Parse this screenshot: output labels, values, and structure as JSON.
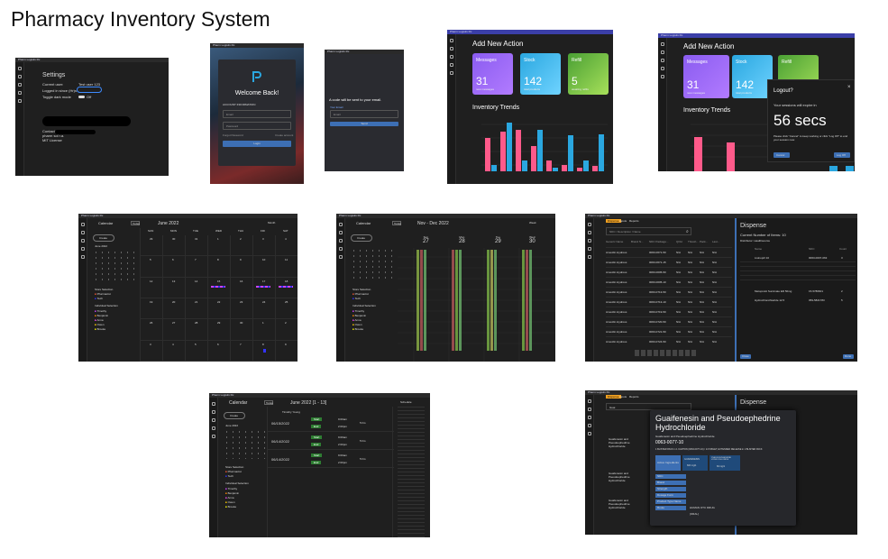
{
  "page_title": "Pharmacy Inventory System",
  "colors": {
    "window_bg": "#1f1f1f",
    "titlebar": "#3b3fa8",
    "accent_blue": "#3d6fb4",
    "pink": "#ff5a8a",
    "teal": "#2aa7e0"
  },
  "settings": {
    "window_title": "Pharm Logistix Rx",
    "heading": "Settings",
    "current_user_label": "Current user:",
    "current_user_value": "Test user 123",
    "logged_in_label": "Logged in since (Hr)s",
    "toggle_label": "Toggle dark mode",
    "toggle_value": "Off",
    "contact_label": "Contact",
    "contact_line": "pharm sol r.a.",
    "license": "MIT License"
  },
  "login": {
    "window_title": "Pharm Logistix Rx",
    "welcome": "Welcome Back!",
    "section": "ACCOUNT INFORMATION",
    "email_placeholder": "Email",
    "password_placeholder": "Password",
    "forgot": "Forgot Password",
    "create": "Create account",
    "login_button": "Login"
  },
  "reset": {
    "window_title": "Pharm Logistix Rx",
    "message": "A code will be sent to your email.",
    "field_label": "Your Email",
    "field_placeholder": "Email",
    "send_button": "Send"
  },
  "dashboard": {
    "window_title": "Pharm Logistix Rx",
    "heading": "Add New Action",
    "cards": [
      {
        "label": "Messages",
        "value": "31",
        "sub": "new messages",
        "color": "#8a5cf0"
      },
      {
        "label": "Stock",
        "value": "142",
        "sub": "total products",
        "color": "#39a8e6"
      },
      {
        "label": "Refill",
        "value": "5",
        "sub": "awaiting refills",
        "color": "#5fb83a"
      }
    ],
    "trends_title": "Inventory Trends"
  },
  "logout": {
    "window_title": "Pharm Logistix Rx",
    "heading": "Add New Action",
    "trends_title": "Inventory Trends",
    "cards": [
      {
        "label": "Messages",
        "value": "31",
        "sub": "new messages",
        "color": "#8a5cf0"
      },
      {
        "label": "Stock",
        "value": "142",
        "sub": "total products",
        "color": "#39a8e6"
      },
      {
        "label": "Refill",
        "value": "",
        "sub": "",
        "color": "#6ab02f"
      }
    ],
    "dialog_title": "Logout?",
    "dialog_line": "Your sessions will expire in",
    "countdown": "56 secs",
    "dialog_note": "Please click \"Cancel\" to keep working or click \"Log Off\" to end your session now.",
    "cancel": "Cancel",
    "logoff": "Log Off"
  },
  "calendar_month": {
    "window_title": "Pharm Logistix Rx",
    "app_label": "Calendar",
    "today": "Today",
    "range": "June 2022",
    "view": "Month",
    "create": "Create",
    "mini_title": "June 2022",
    "day_headers": [
      "SUN",
      "MON",
      "TUE",
      "WED",
      "THU",
      "FRI",
      "SAT"
    ],
    "dates": [
      "29",
      "30",
      "31",
      "1",
      "2",
      "3",
      "4",
      "5",
      "6",
      "7",
      "8",
      "9",
      "10",
      "11",
      "12",
      "13",
      "14",
      "15",
      "16",
      "17",
      "18",
      "19",
      "20",
      "21",
      "22",
      "23",
      "24",
      "25",
      "26",
      "27",
      "28",
      "29",
      "30",
      "1",
      "2",
      "3",
      "4",
      "5",
      "6",
      "7",
      "8",
      "9"
    ],
    "store_title": "Store Selection",
    "stores": [
      "Pharmacist",
      "Tech"
    ],
    "people_title": "Individual Selection",
    "people": [
      "Timothy",
      "Benjamin",
      "Anna",
      "Owen",
      "Brooke"
    ]
  },
  "calendar_week": {
    "window_title": "Pharm Logistix Rx",
    "app_label": "Calendar",
    "today": "Today",
    "range": "Nov - Dec 2022",
    "view": "Week",
    "create": "Create",
    "cols": [
      {
        "day": "Sun",
        "date": "27"
      },
      {
        "day": "Mon",
        "date": "28"
      },
      {
        "day": "Tue",
        "date": "29"
      },
      {
        "day": "Wed",
        "date": "30"
      }
    ],
    "store_title": "Store Selection",
    "stores": [
      "Pharmacist",
      "Tech"
    ],
    "people_title": "Individual Selection",
    "people": [
      "Timothy",
      "Benjamin",
      "Anna",
      "Owen",
      "Brooke"
    ]
  },
  "dispense": {
    "window_title": "Pharm Logistix Rx",
    "tabs": [
      "Dispense",
      "Inputs",
      "Reports"
    ],
    "search_placeholder": "NDC / Description / Name",
    "columns": [
      "Generic Name",
      "Brand N...",
      "NDC Package...",
      "QOH",
      "Thresh...",
      "Pack...",
      "Last..."
    ],
    "rows": [
      [
        "Amoxilin Hydrous",
        "",
        "0063-0671-50",
        "N/A",
        "N/A",
        "N/A",
        "N/A"
      ],
      [
        "Amoxilin Hydrous",
        "",
        "0063-0671-15",
        "N/A",
        "N/A",
        "N/A",
        "N/A"
      ],
      [
        "Amoxilin Hydrous",
        "",
        "0063-0005-50",
        "N/A",
        "N/A",
        "N/A",
        "N/A"
      ],
      [
        "Amoxilin Hydrous",
        "",
        "0063-0005-10",
        "N/A",
        "N/A",
        "N/A",
        "N/A"
      ],
      [
        "Amoxilin Hydrous",
        "",
        "0063-0713-50",
        "N/A",
        "N/A",
        "N/A",
        "N/A"
      ],
      [
        "Amoxilin Hydrous",
        "",
        "0063-0713-10",
        "N/A",
        "N/A",
        "N/A",
        "N/A"
      ],
      [
        "Amoxilin Hydrous",
        "",
        "0063-0719-50",
        "N/A",
        "N/A",
        "N/A",
        "N/A"
      ],
      [
        "Amoxilin Hydrous",
        "",
        "0063-0720-50",
        "N/A",
        "N/A",
        "N/A",
        "N/A"
      ],
      [
        "Amoxilin Hydrous",
        "",
        "0063-0721-50",
        "N/A",
        "N/A",
        "N/A",
        "N/A"
      ],
      [
        "Amoxilin Hydrous",
        "",
        "0063-0724-50",
        "N/A",
        "N/A",
        "N/A",
        "N/A"
      ]
    ],
    "panel_title": "Dispense",
    "current_items": "Current Number of Items: 10",
    "distributor": "Distributor: Healthsource",
    "panel_cols": [
      "Name",
      "NDC",
      "Count"
    ],
    "panel_rows": [
      {
        "name": "Lisinopril 10",
        "ndc": "0063-0007-063",
        "count": "3"
      },
      {
        "name": "Metoprolol Succinate ER 50mg",
        "ndc": "15-5786601",
        "count": "2"
      },
      {
        "name": "Hydrochlorothiazide 12.5",
        "ndc": "059-5821783",
        "count": "5"
      }
    ],
    "close": "Close",
    "done": "Done"
  },
  "schedule": {
    "window_title": "Pharm Logistix Rx",
    "app_label": "Calendar",
    "today": "Today",
    "range": "June 2022 [1 - 13]",
    "view": "Schedule",
    "create": "Create",
    "mini_title": "June 2022",
    "person": "Timothy Young",
    "entries": [
      {
        "date": "06/15/2022",
        "status": "Start",
        "time": "9:00am"
      },
      {
        "date": "06/15/2022",
        "status": "End",
        "time": "2:00pm",
        "hours": "5 hrs"
      },
      {
        "date": "06/14/2022",
        "status": "Start",
        "time": "9:00am"
      },
      {
        "date": "06/14/2022",
        "status": "End",
        "time": "2:00pm",
        "hours": "5 hrs"
      },
      {
        "date": "06/14/2022",
        "status": "Start",
        "time": "9:00am"
      },
      {
        "date": "06/14/2022",
        "status": "End",
        "time": "2:00pm",
        "hours": "5 hrs"
      }
    ],
    "store_title": "Store Selection",
    "stores": [
      "Pharmacist",
      "Tech"
    ],
    "people_title": "Individual Selection",
    "people": [
      "Timothy",
      "Benjamin",
      "Anna",
      "Owen",
      "Brooke"
    ]
  },
  "drug_detail": {
    "window_title": "Pharm Logistix Rx",
    "tabs": [
      "Dispense",
      "Inputs",
      "Reports"
    ],
    "search_placeholder": "Guai",
    "panel_title": "Dispense",
    "current_items": "Current Number of Items: 10",
    "popup_title": "Guaifenesin and Pseudoephedrine Hydrochloride",
    "popup_subtitle": "Guaifenesin and Pseudoephedrine Hydrochloride",
    "ndc": "0063-0077-10",
    "package": "1 BLISTER PACK in 1 CARTON (0063-0077-10) / 14 TABLET, EXTENDED RELEASE in 1 BLISTER PACK",
    "active_label": "Active Ingredients",
    "ingredients": [
      {
        "name": "GUAIFENESIN",
        "dose": "600 mg/1"
      },
      {
        "name": "PSEUDOEPHEDRINE HYDROCHLORIDE",
        "dose": "60 mg/1"
      }
    ],
    "fields": [
      "NDC",
      "Brand",
      "Strength",
      "Dosage Form",
      "Product Type Name",
      "Route"
    ],
    "product_type_value": "HUMAN OTC DRUG",
    "route_value": "[ORAL]",
    "generic_rows": [
      "Guaifenesin and Pseudoephedrine Hydrochloride",
      "Guaifenesin and Pseudoephedrine Hydrochloride",
      "Guaifenesin and Pseudoephedrine Hydrochloride"
    ]
  }
}
